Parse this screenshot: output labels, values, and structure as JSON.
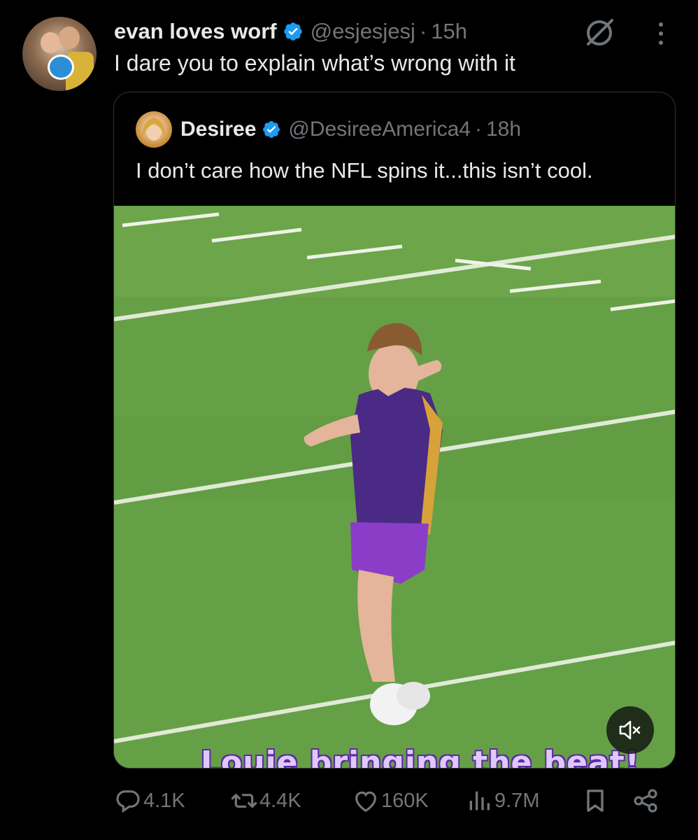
{
  "tweet": {
    "author": {
      "name": "evan loves worf",
      "handle": "@esjesjesj",
      "separator": "·",
      "time": "15h",
      "verified": true
    },
    "text": "I dare you to explain what’s wrong with it",
    "quoted": {
      "author": {
        "name": "Desiree",
        "handle": "@DesireeAmerica4",
        "separator": "·",
        "time": "18h",
        "verified": true
      },
      "text": "I don’t care how the NFL spins it...this isn’t cool.",
      "video": {
        "caption": "Louie bringing the beat!",
        "muted": true
      }
    },
    "metrics": {
      "replies": "4.1K",
      "reposts": "4.4K",
      "likes": "160K",
      "views": "9.7M"
    }
  },
  "colors": {
    "background": "#000000",
    "text": "#e7e9ea",
    "secondary": "#71767b",
    "verified": "#1d9bf0",
    "border": "#2f3336"
  }
}
